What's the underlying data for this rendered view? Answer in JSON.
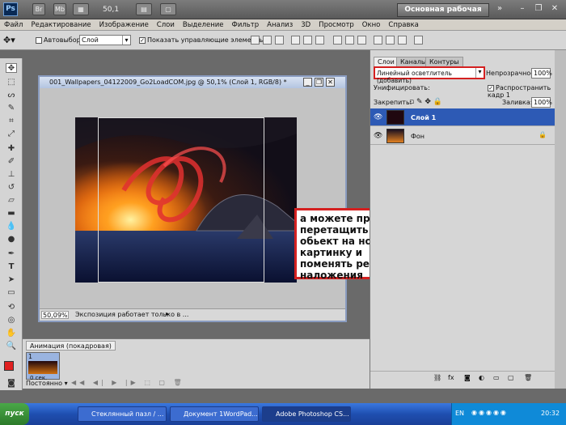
{
  "app": {
    "logo": "Ps",
    "bridge_btn": "Br",
    "minibridge_btn": "Mb",
    "zoom": "50,1",
    "workspace": "Основная рабочая среда"
  },
  "menu": [
    "Файл",
    "Редактирование",
    "Изображение",
    "Слои",
    "Выделение",
    "Фильтр",
    "Анализ",
    "3D",
    "Просмотр",
    "Окно",
    "Справка"
  ],
  "options": {
    "autoselect_label": "Автовыбор:",
    "autoselect_value": "Слой",
    "show_controls_label": "Показать управляющие элементы"
  },
  "document": {
    "title": "001_Wallpapers_04122009_Go2LoadCOM.jpg @ 50,1% (Слой 1, RGB/8) *",
    "zoom": "50,09%",
    "status": "Экспозиция работает только в ..."
  },
  "callout": {
    "text": "а можете просто перетащить обьект на новую картинку и поменять режим наложения"
  },
  "layers_panel": {
    "tabs": [
      "Слои",
      "Каналы",
      "Контуры"
    ],
    "blend_mode": "Линейный осветлитель (добавить)",
    "opacity_label": "Непрозрачность:",
    "opacity_value": "100%",
    "unify_label": "Унифицировать:",
    "propagate_label": "Распространить кадр 1",
    "lock_label": "Закрепить:",
    "fill_label": "Заливка:",
    "fill_value": "100%",
    "layers": [
      {
        "name": "Слой 1",
        "selected": true
      },
      {
        "name": "Фон",
        "selected": false
      }
    ]
  },
  "animation_panel": {
    "title": "Анимация (покадровая)",
    "frame_number": "1",
    "frame_delay": "0 сек.",
    "loop": "Постоянно"
  },
  "taskbar": {
    "start": "пуск",
    "tasks": [
      "Стеклянный пазл / ...",
      "Документ 1WordPad...",
      "Adobe Photoshop CS..."
    ],
    "lang": "EN",
    "time": "20:32"
  },
  "colors": {
    "accent_selected_layer": "#2d5ab5",
    "callout_border": "#d42020",
    "taskbar": "#245edb"
  }
}
